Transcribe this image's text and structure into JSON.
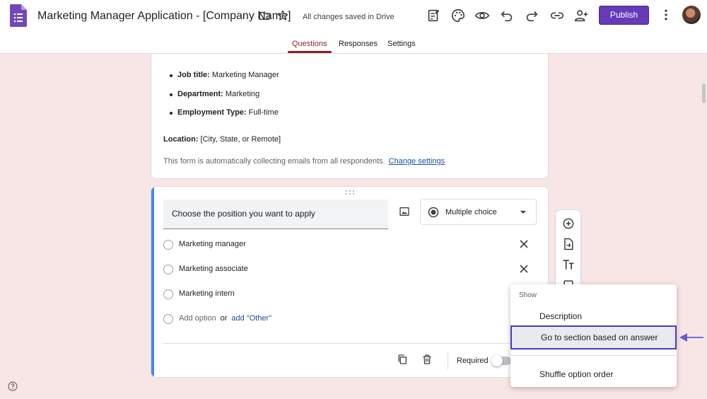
{
  "header": {
    "title": "Marketing Manager Application - [Company Name]",
    "save_status": "All changes saved in Drive",
    "publish_label": "Publish",
    "icons": [
      "forms-logo-icon",
      "folder-icon",
      "star-icon",
      "customize-icon",
      "palette-icon",
      "preview-eye-icon",
      "undo-icon",
      "redo-icon",
      "link-icon",
      "add-collaborator-icon",
      "more-vert-icon"
    ]
  },
  "tabs": [
    {
      "label": "Questions",
      "active": true
    },
    {
      "label": "Responses",
      "active": false
    },
    {
      "label": "Settings",
      "active": false
    }
  ],
  "description_card": {
    "bullets": [
      {
        "key": "Job title:",
        "value": " Marketing Manager"
      },
      {
        "key": "Department:",
        "value": " Marketing"
      },
      {
        "key": "Employment Type:",
        "value": " Full-time"
      }
    ],
    "location_key": "Location:",
    "location_value": " [City, State, or Remote]",
    "email_note": "This form is automatically collecting emails from all respondents.",
    "change_settings": "Change settings"
  },
  "question": {
    "title": "Choose the position you want to apply",
    "type": "Multiple choice",
    "options": [
      "Marketing manager",
      "Marketing associate",
      "Marketing intern"
    ],
    "add_option": "Add option",
    "or_text": "or",
    "add_other": "add \"Other\"",
    "required_label": "Required",
    "required": false
  },
  "menu": {
    "header": "Show",
    "items": [
      "Description",
      "Go to section based on answer",
      "Shuffle option order"
    ],
    "selected_index": 1
  },
  "colors": {
    "accent": "#673ab7",
    "background": "#f8e6e6",
    "active_tab": "#8b1e1e",
    "question_accent": "#4285f4",
    "highlight_border": "#4b3bc4"
  }
}
